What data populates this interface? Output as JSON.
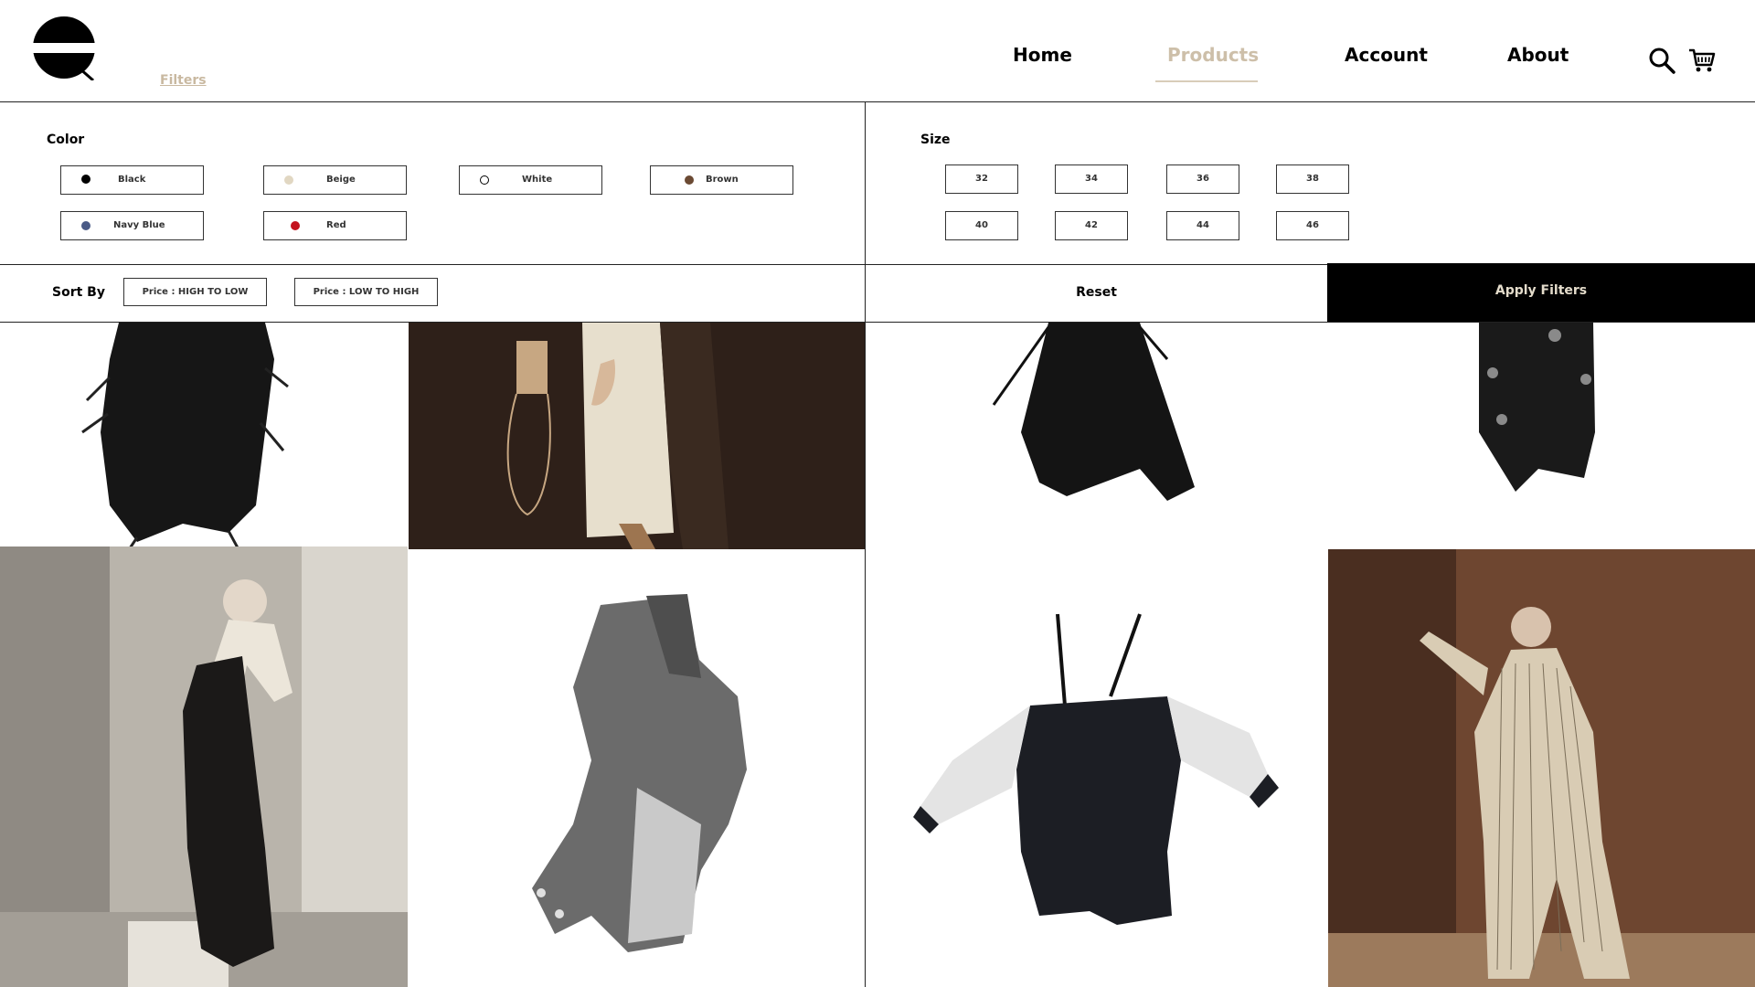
{
  "header": {
    "filters_label": "Filters",
    "nav": [
      {
        "label": "Home",
        "active": false
      },
      {
        "label": "Products",
        "active": true
      },
      {
        "label": "Account",
        "active": false
      },
      {
        "label": "About",
        "active": false
      }
    ],
    "icons": [
      "logo-icon",
      "search-icon",
      "cart-icon"
    ]
  },
  "filters": {
    "color": {
      "title": "Color",
      "options": [
        {
          "label": "Black",
          "swatch": "#000000"
        },
        {
          "label": "Beige",
          "swatch": "#e1d7c2"
        },
        {
          "label": "White",
          "swatch": "#ffffff"
        },
        {
          "label": "Brown",
          "swatch": "#6b4a33"
        },
        {
          "label": "Navy Blue",
          "swatch": "#4a5a86"
        },
        {
          "label": "Red",
          "swatch": "#c4121e"
        }
      ]
    },
    "size": {
      "title": "Size",
      "options": [
        "32",
        "34",
        "36",
        "38",
        "40",
        "42",
        "44",
        "46"
      ]
    }
  },
  "sort": {
    "label": "Sort By",
    "options": [
      "Price : HIGH TO LOW",
      "Price : LOW TO HIGH"
    ]
  },
  "actions": {
    "reset": "Reset",
    "apply": "Apply Filters"
  },
  "colors": {
    "accent": "#cdbfa9",
    "border": "#222222",
    "apply_bg": "#000000",
    "apply_text": "#e4dccb"
  }
}
